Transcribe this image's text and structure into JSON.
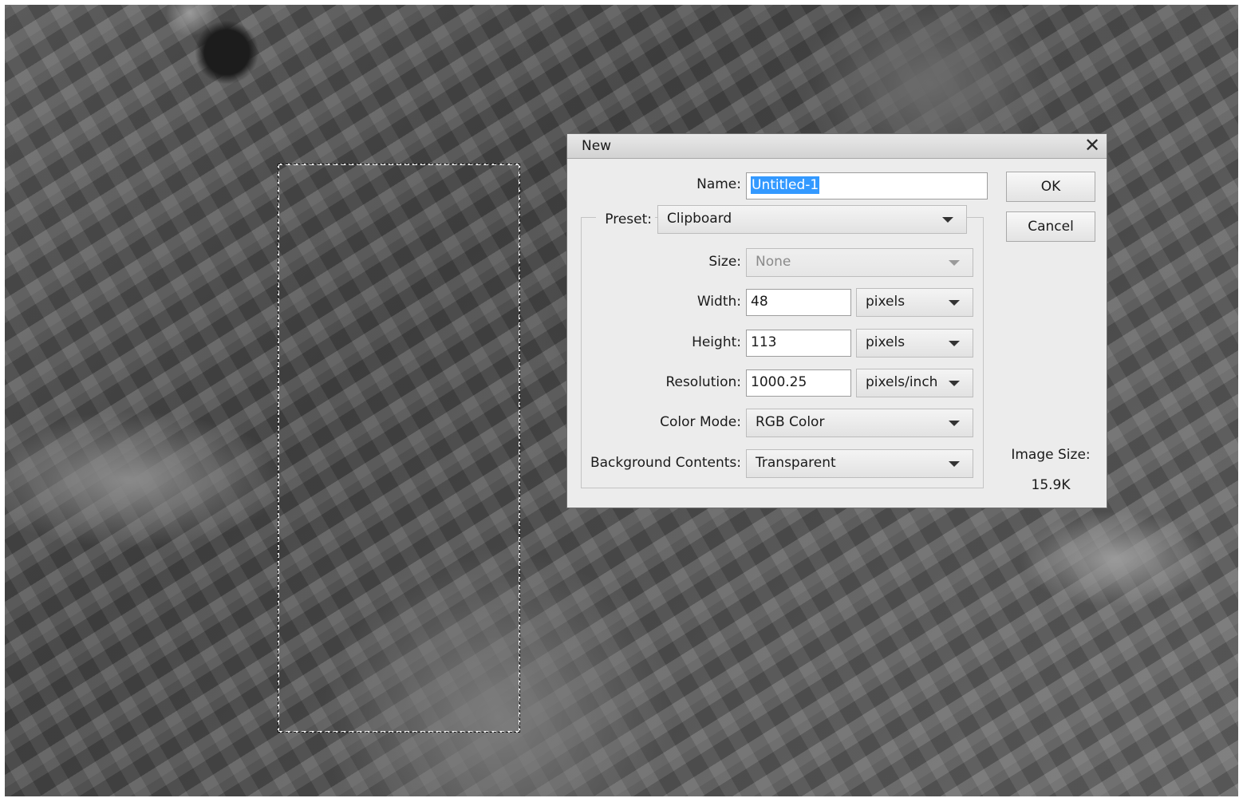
{
  "dialog": {
    "title": "New",
    "close_icon": "close-icon"
  },
  "form": {
    "name_label": "Name:",
    "name_value": "Untitled-1",
    "preset_label": "Preset:",
    "preset_value": "Clipboard",
    "size_label": "Size:",
    "size_value": "None",
    "width_label": "Width:",
    "width_value": "48",
    "width_unit": "pixels",
    "height_label": "Height:",
    "height_value": "113",
    "height_unit": "pixels",
    "resolution_label": "Resolution:",
    "resolution_value": "1000.25",
    "resolution_unit": "pixels/inch",
    "color_mode_label": "Color Mode:",
    "color_mode_value": "RGB Color",
    "background_label": "Background Contents:",
    "background_value": "Transparent"
  },
  "buttons": {
    "ok": "OK",
    "cancel": "Cancel"
  },
  "image_size": {
    "label": "Image Size:",
    "value": "15.9K"
  },
  "colors": {
    "selection_highlight": "#3399ff",
    "dialog_bg": "#ececec"
  }
}
